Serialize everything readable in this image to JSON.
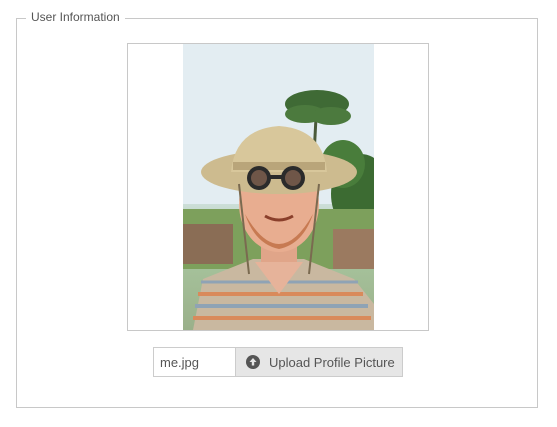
{
  "section": {
    "legend": "User Information"
  },
  "profile": {
    "photo_alt": "profile picture",
    "icon": "person-in-safari-hat-photo"
  },
  "upload": {
    "filename": "me.jpg",
    "button_label": "Upload Profile Picture",
    "button_icon": "arrow-up-circle-icon"
  },
  "colors": {
    "border": "#c8c8c8",
    "button_bg": "#e6e6e6",
    "text": "#555555"
  }
}
